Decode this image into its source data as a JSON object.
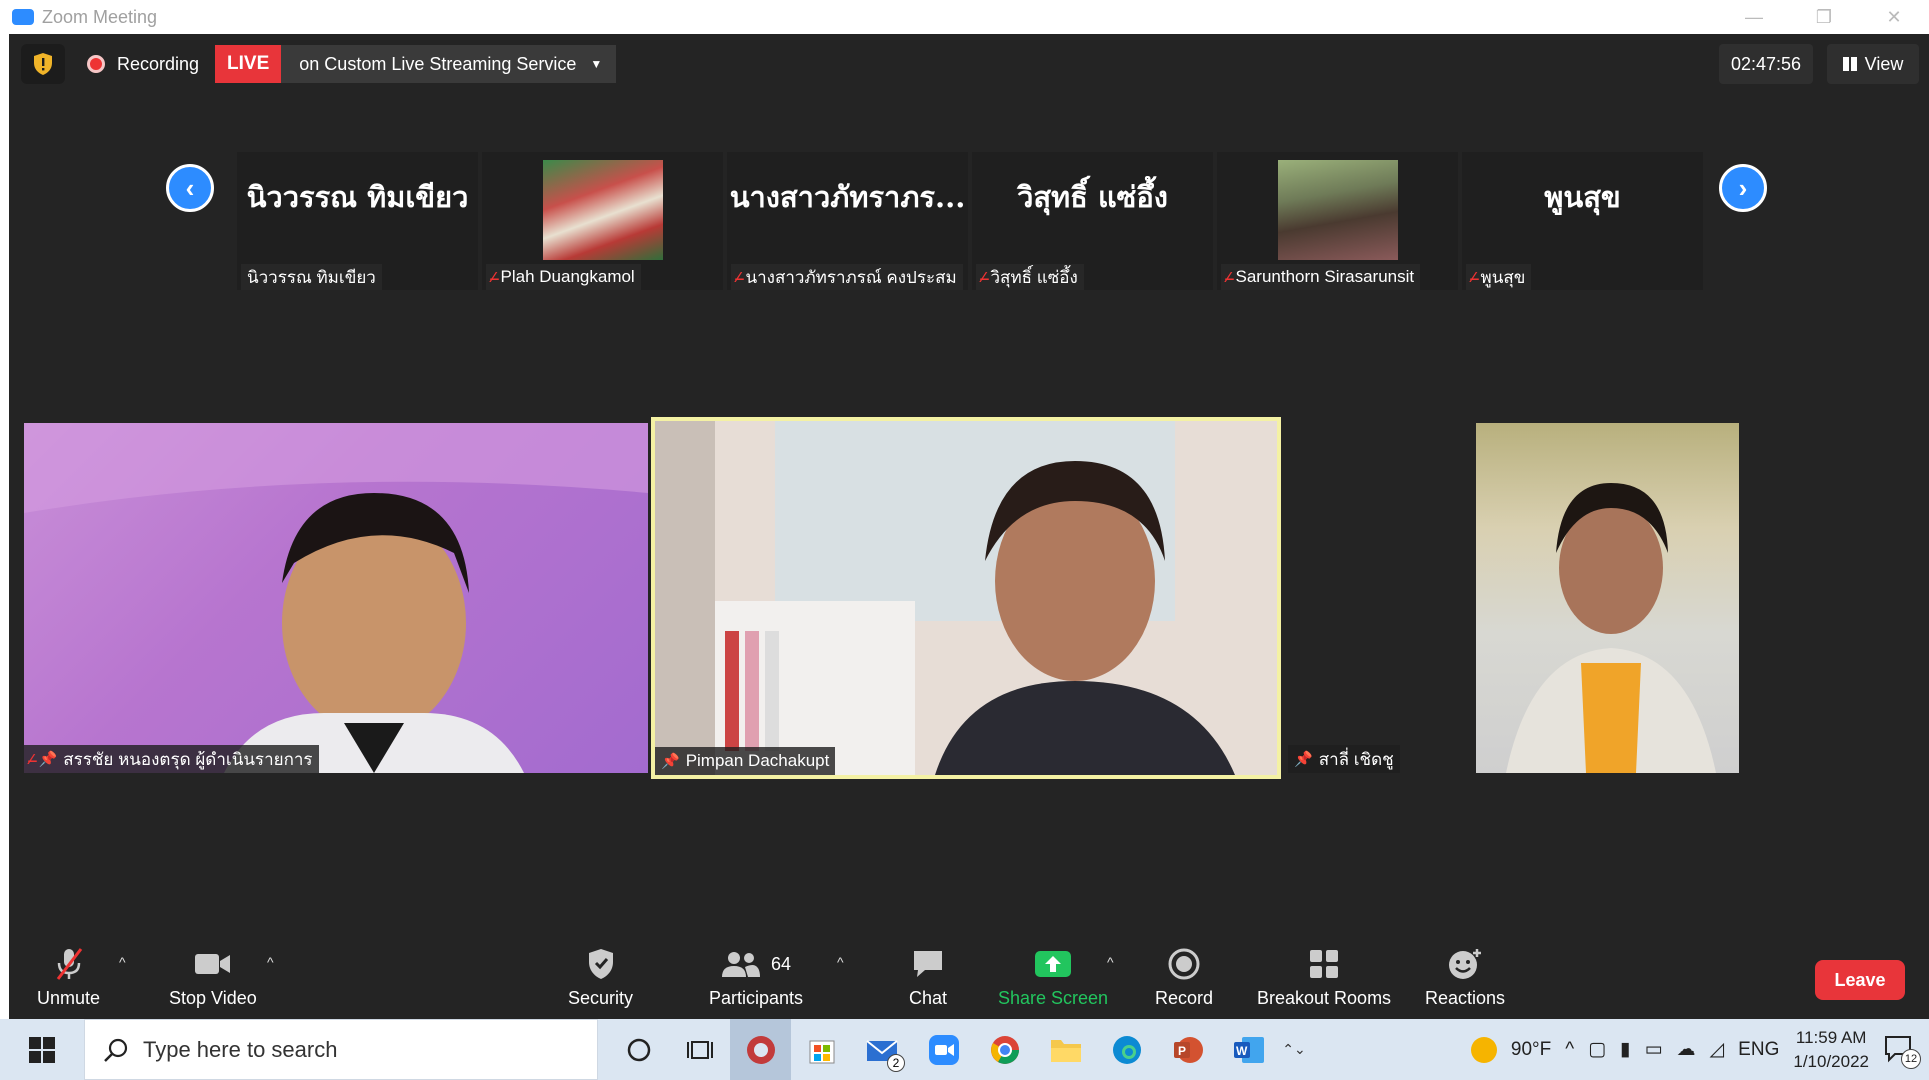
{
  "window": {
    "title": "Zoom Meeting"
  },
  "topbar": {
    "recording_label": "Recording",
    "live_label": "LIVE",
    "stream_label": "on Custom Live Streaming Service",
    "timer": "02:47:56",
    "view_label": "View"
  },
  "gallery_strip": [
    {
      "big_name": "นิววรรณ ทิมเขียว",
      "tag": "นิววรรณ ทิมเขียว",
      "muted": false,
      "has_video": false
    },
    {
      "big_name": "",
      "tag": "Plah Duangkamol",
      "muted": true,
      "has_video": true
    },
    {
      "big_name": "นางสาวภัทราภร...",
      "tag": "นางสาวภัทราภรณ์ คงประสม",
      "muted": true,
      "has_video": false
    },
    {
      "big_name": "วิสุทธิ์ แซ่อึ้ง",
      "tag": "วิสุทธิ์ แซ่อึ้ง",
      "muted": true,
      "has_video": false
    },
    {
      "big_name": "",
      "tag": "Sarunthorn Sirasarunsit",
      "muted": true,
      "has_video": true
    },
    {
      "big_name": "พูนสุข",
      "tag": "พูนสุข",
      "muted": true,
      "has_video": false
    }
  ],
  "stage": [
    {
      "tag": "สรรชัย หนองตรุด ผู้ดำเนินรายการ",
      "muted": true,
      "pinned": true
    },
    {
      "tag": "Pimpan Dachakupt",
      "muted": false,
      "pinned": true
    },
    {
      "tag": "สาลี่ เชิดชู",
      "muted": false,
      "pinned": true
    }
  ],
  "toolbar": {
    "unmute": "Unmute",
    "stop_video": "Stop Video",
    "security": "Security",
    "participants": "Participants",
    "participants_count": "64",
    "chat": "Chat",
    "share_screen": "Share Screen",
    "record": "Record",
    "breakout_rooms": "Breakout Rooms",
    "reactions": "Reactions",
    "leave": "Leave"
  },
  "taskbar": {
    "search_placeholder": "Type here to search",
    "weather": "90°F",
    "language": "ENG",
    "time": "11:59 AM",
    "date": "1/10/2022",
    "mail_badge": "2",
    "notification_count": "12"
  },
  "colors": {
    "zoom_blue": "#2d8cff",
    "live_red": "#e8353a",
    "share_green": "#22c55e",
    "active_speaker_border": "#f4f1a4"
  }
}
